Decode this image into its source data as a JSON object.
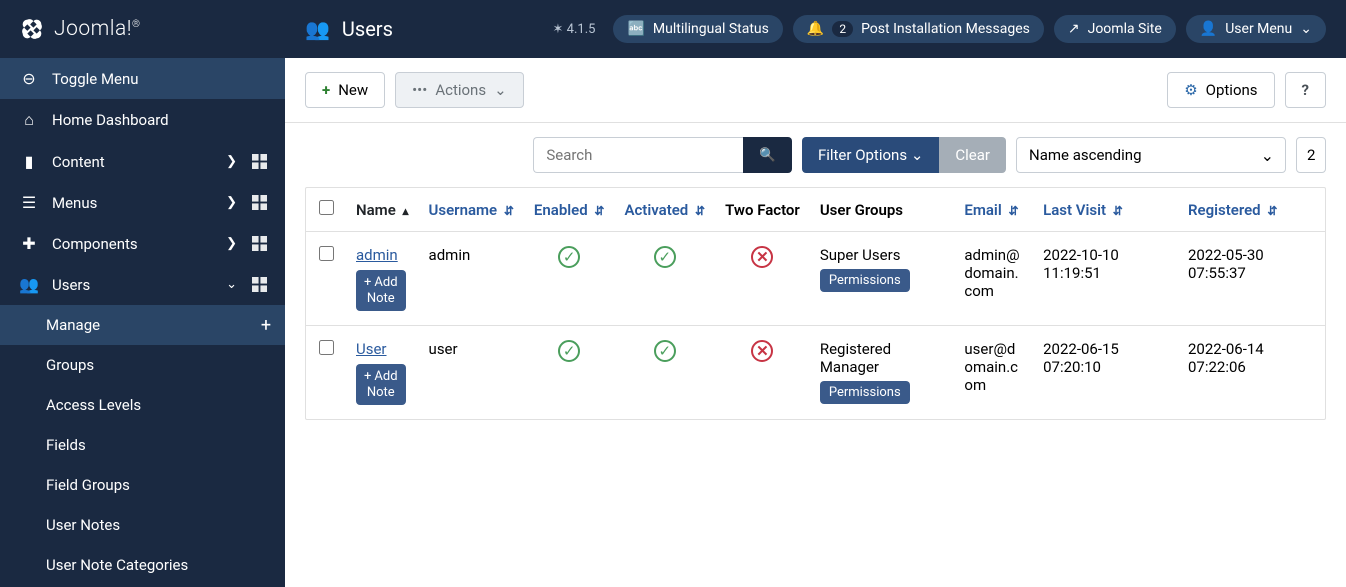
{
  "brand": "Joomla!",
  "sidebar": {
    "toggle": "Toggle Menu",
    "items": [
      {
        "icon": "home",
        "label": "Home Dashboard"
      },
      {
        "icon": "file",
        "label": "Content",
        "chevron": true,
        "grid": true
      },
      {
        "icon": "list",
        "label": "Menus",
        "chevron": true,
        "grid": true
      },
      {
        "icon": "puzzle",
        "label": "Components",
        "chevron": true,
        "grid": true
      },
      {
        "icon": "users",
        "label": "Users",
        "chevron": "down",
        "grid": true,
        "expanded": true
      }
    ],
    "sub": [
      {
        "label": "Manage",
        "active": true,
        "plus": true
      },
      {
        "label": "Groups"
      },
      {
        "label": "Access Levels"
      },
      {
        "label": "Fields"
      },
      {
        "label": "Field Groups"
      },
      {
        "label": "User Notes"
      },
      {
        "label": "User Note Categories"
      }
    ]
  },
  "header": {
    "title": "Users",
    "version": "4.1.5",
    "multilingual": "Multilingual Status",
    "notif_count": "2",
    "post_install": "Post Installation Messages",
    "site": "Joomla Site",
    "user_menu": "User Menu"
  },
  "toolbar": {
    "new": "New",
    "actions": "Actions",
    "options": "Options",
    "help": "?"
  },
  "filters": {
    "search_placeholder": "Search",
    "filter_options": "Filter Options",
    "clear": "Clear",
    "sort": "Name ascending",
    "limit": "2"
  },
  "columns": {
    "name": "Name",
    "username": "Username",
    "enabled": "Enabled",
    "activated": "Activated",
    "twofactor": "Two Factor",
    "groups": "User Groups",
    "email": "Email",
    "lastvisit": "Last Visit",
    "registered": "Registered"
  },
  "rows": [
    {
      "name": "admin",
      "username": "admin",
      "enabled": true,
      "activated": true,
      "twofactor": false,
      "groups": "Super Users",
      "email": "admin@domain.com",
      "lastvisit": "2022-10-10 11:19:51",
      "registered": "2022-05-30 07:55:37"
    },
    {
      "name": "User",
      "username": "user",
      "enabled": true,
      "activated": true,
      "twofactor": false,
      "groups": "Registered Manager",
      "email": "user@domain.com",
      "lastvisit": "2022-06-15 07:20:10",
      "registered": "2022-06-14 07:22:06"
    }
  ],
  "labels": {
    "add_note": "Add Note",
    "permissions": "Permissions"
  }
}
